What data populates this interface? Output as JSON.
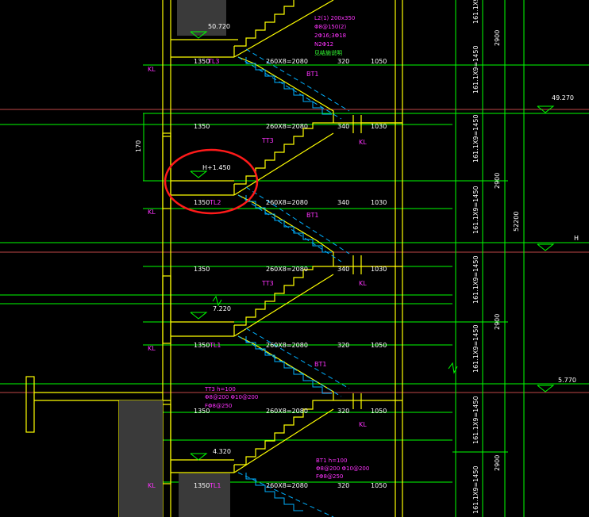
{
  "drawing": {
    "colors": {
      "background": "#000000",
      "wall": "#ffff00",
      "dimension": "#00ff00",
      "stair_hidden": "#00b0ff",
      "label": "#ff33ff",
      "text": "#ffffff",
      "annotation_red": "#ff1a1a",
      "gridline": "#ff6060"
    },
    "dimension_labels": {
      "landing_1350": "1350",
      "flight_2080": "260X8=2080",
      "run_320": "320",
      "run_1050": "1050",
      "run_340": "340",
      "run_1030": "1030",
      "total_2900": "2900",
      "total_52200": "52200",
      "riser_spec": "161.1X9=1450",
      "height_170": "170"
    },
    "elevations": {
      "e50_720": "50.720",
      "e49_270": "49.270",
      "h_label": "H",
      "h_1450": "H+1.450",
      "e7_220": "7.220",
      "e5_770": "5.770",
      "e4_320": "4.320"
    },
    "tags": {
      "kl": "KL",
      "tl1": "TL1",
      "tl2": "TL2",
      "tl3": "TL3",
      "bt1": "BT1",
      "tt3": "TT3"
    },
    "notes": {
      "l2_1": "L2(1) 200x350",
      "l2_2": "Φ8@150(2)",
      "l2_3": "2Φ16;3Φ18",
      "l2_4": "N2Φ12",
      "green_note": "见结施说明",
      "tt3_1": "TT3 h=100",
      "tt3_2": "Φ8@200 Φ10@200",
      "tt3_3": "FΦ8@250",
      "bt1_1": "BT1 h=100",
      "bt1_2": "Φ8@200 Φ10@200",
      "bt1_3": "FΦ8@250"
    }
  }
}
